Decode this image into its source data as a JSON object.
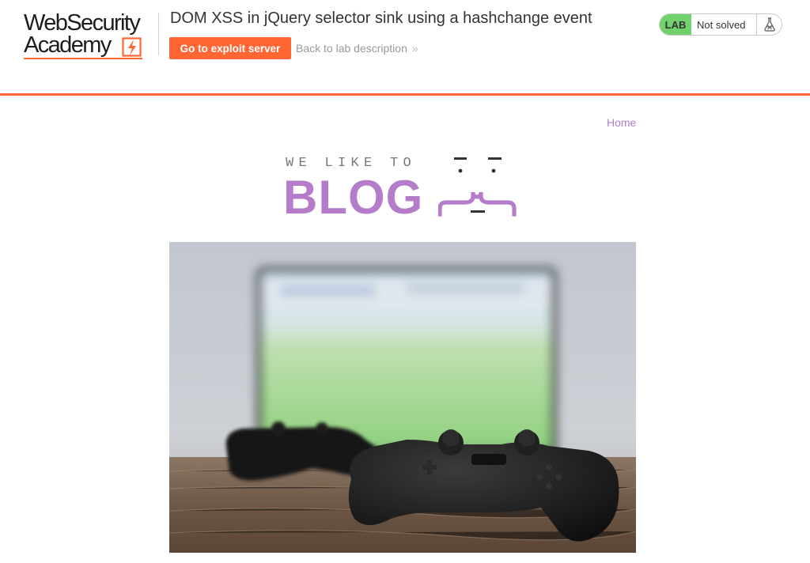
{
  "academy": {
    "logo_line1": "WebSecurity",
    "logo_line2": "Academy",
    "lab_title": "DOM XSS in jQuery selector sink using a hashchange event",
    "exploit_button": "Go to exploit server",
    "back_link": "Back to lab description",
    "back_chevron": "»",
    "status_badge": "LAB",
    "status_text": "Not solved",
    "colors": {
      "accent": "#ff6633",
      "solved_pill": "#70d16d"
    }
  },
  "blog": {
    "nav_home": "Home",
    "banner_tagline": "WE LIKE TO",
    "banner_title": "BLOG",
    "banner_color": "#b57cc9",
    "post_image_icon": "gaming-controllers-image"
  }
}
